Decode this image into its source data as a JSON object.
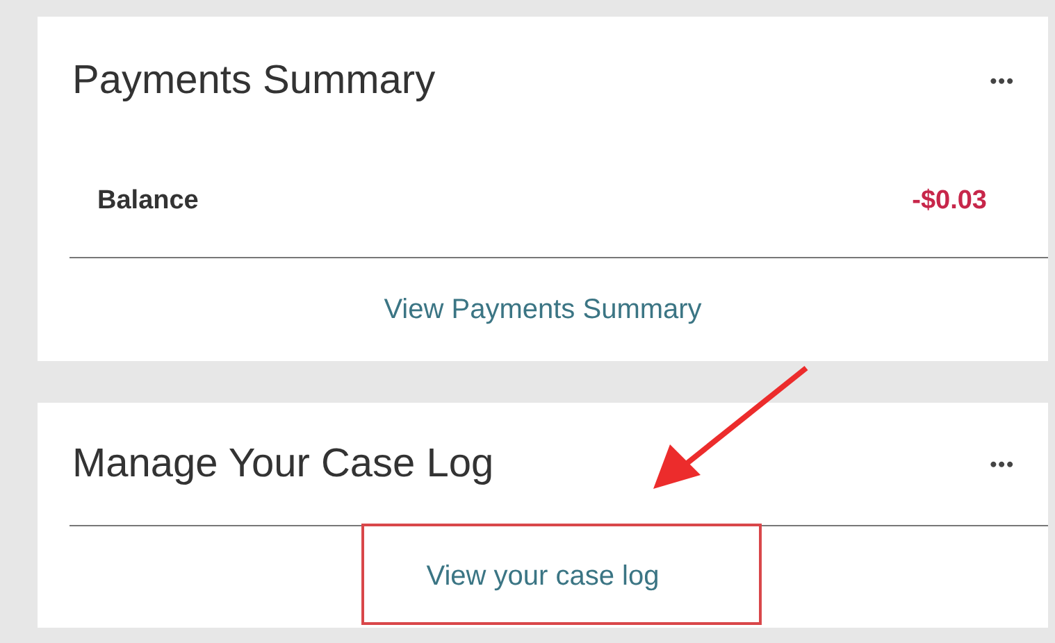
{
  "payments_summary": {
    "title": "Payments Summary",
    "menu": "•••",
    "balance_label": "Balance",
    "balance_value": "-$0.03",
    "link": "View Payments Summary"
  },
  "case_log": {
    "title": "Manage Your Case Log",
    "menu": "•••",
    "link": "View your case log"
  },
  "annotations": {
    "arrow": true,
    "highlight_box": true
  }
}
